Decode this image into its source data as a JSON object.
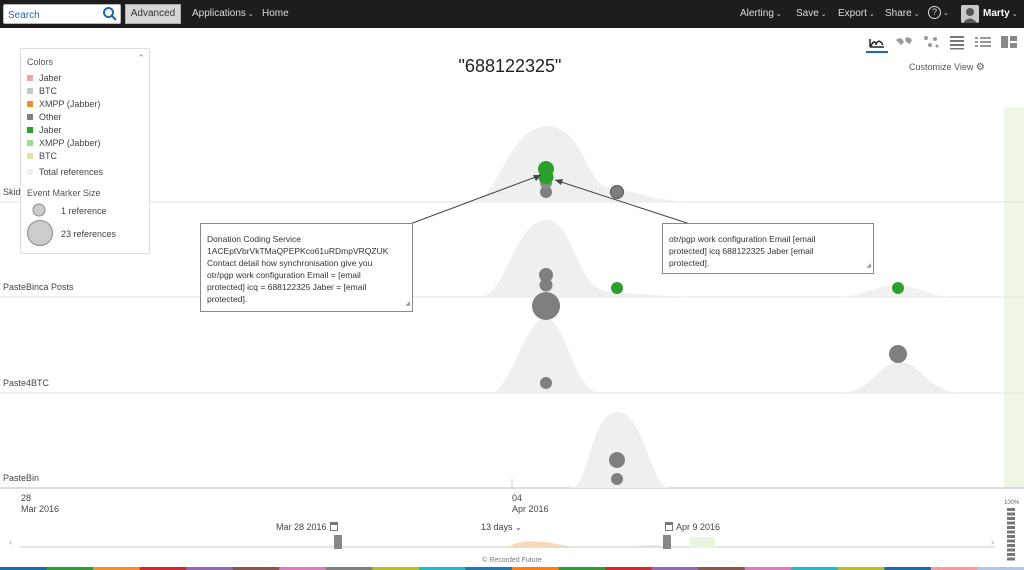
{
  "topbar": {
    "search_placeholder": "Search",
    "advanced_label": "Advanced",
    "left_nav": [
      {
        "label": "Applications",
        "has_chevron": true
      },
      {
        "label": "Home",
        "has_chevron": false
      }
    ],
    "right_nav": [
      {
        "label": "Alerting"
      },
      {
        "label": "Save"
      },
      {
        "label": "Export"
      },
      {
        "label": "Share"
      }
    ],
    "help_label": "?",
    "user_name": "Marty"
  },
  "view": {
    "customize_label": "Customize View",
    "icons": [
      "timeline-icon",
      "map-icon",
      "network-icon",
      "table-icon",
      "list-icon",
      "grid-icon"
    ],
    "active_icon": "timeline-icon"
  },
  "chart_data": {
    "type": "scatter",
    "title": "\"688122325\"",
    "rows": [
      {
        "label": "Skid",
        "events": [
          {
            "date": "2016-04-04",
            "references": 1,
            "color": "#2ca02c"
          },
          {
            "date": "2016-04-04",
            "references": 1,
            "color": "#2ca02c"
          },
          {
            "date": "2016-04-04",
            "references": 1,
            "color": "#7f7f7f"
          },
          {
            "date": "2016-04-06",
            "references": 1,
            "color": "#7f7f7f"
          }
        ]
      },
      {
        "label": "PasteBinca Posts",
        "events": [
          {
            "date": "2016-04-04",
            "references": 1,
            "color": "#7f7f7f"
          },
          {
            "date": "2016-04-04",
            "references": 23,
            "color": "#7f7f7f"
          },
          {
            "date": "2016-04-06",
            "references": 1,
            "color": "#2ca02c"
          },
          {
            "date": "2016-04-12",
            "references": 1,
            "color": "#2ca02c"
          }
        ]
      },
      {
        "label": "Paste4BTC",
        "events": [
          {
            "date": "2016-04-04",
            "references": 1,
            "color": "#7f7f7f"
          },
          {
            "date": "2016-04-12",
            "references": 2,
            "color": "#7f7f7f"
          }
        ]
      },
      {
        "label": "PasteBin",
        "events": [
          {
            "date": "2016-04-06",
            "references": 2,
            "color": "#7f7f7f"
          },
          {
            "date": "2016-04-06",
            "references": 1,
            "color": "#7f7f7f"
          }
        ]
      }
    ],
    "x_ticks": [
      {
        "day": "28",
        "month": "Mar 2016"
      },
      {
        "day": "04",
        "month": "Apr 2016"
      }
    ],
    "legend_placement": "top-left"
  },
  "legend": {
    "title": "Colors",
    "items": [
      {
        "label": "Jaber",
        "color": "#f4a6a6"
      },
      {
        "label": "BTC",
        "color": "#c8c8c8"
      },
      {
        "label": "XMPP (Jabber)",
        "color": "#f28e2b"
      },
      {
        "label": "Other",
        "color": "#7f7f7f"
      },
      {
        "label": "Jaber",
        "color": "#2ca02c"
      },
      {
        "label": "XMPP (Jabber)",
        "color": "#98df8a"
      },
      {
        "label": "BTC",
        "color": "#dbe6a6"
      }
    ],
    "total_label": "Total references",
    "marker_title": "Event Marker Size",
    "marker_small": "1 reference",
    "marker_large": "23 references"
  },
  "callouts": [
    {
      "lines": [
        "Donation Coding Service",
        "1ACEptVbrVkTMaQPEPKco61uRDmpVRQZUK",
        "Contact detail how synchronisation give you",
        "otr/pgp work configuration Email = [email",
        "protected] icq = 688122325 Jaber = [email",
        "protected]."
      ]
    },
    {
      "lines": [
        "otr/pgp work configuration Email [email",
        "protected] icq 688122325 Jaber [email",
        "protected]."
      ]
    }
  ],
  "range": {
    "start": "Mar 28 2016",
    "end": "Apr 9 2016",
    "span": "13 days",
    "percent": "100%"
  },
  "footer": "© Recorded Future"
}
